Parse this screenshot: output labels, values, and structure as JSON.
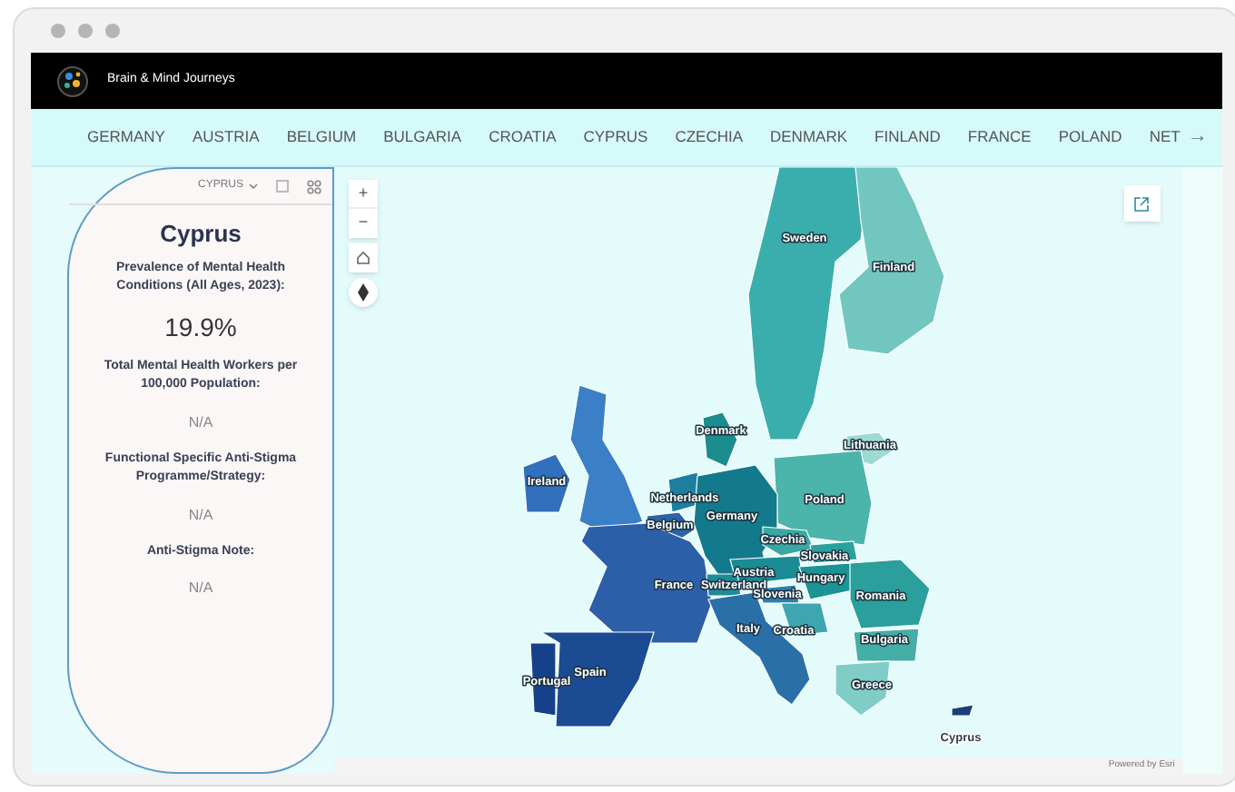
{
  "header": {
    "title": "Brain & Mind Journeys"
  },
  "nav": {
    "items": [
      {
        "label": "GERMANY",
        "selected": false
      },
      {
        "label": "AUSTRIA",
        "selected": false
      },
      {
        "label": "BELGIUM",
        "selected": false
      },
      {
        "label": "BULGARIA",
        "selected": false
      },
      {
        "label": "CROATIA",
        "selected": false
      },
      {
        "label": "CYPRUS",
        "selected": false
      },
      {
        "label": "CZECHIA",
        "selected": false
      },
      {
        "label": "DENMARK",
        "selected": false
      },
      {
        "label": "FINLAND",
        "selected": false
      },
      {
        "label": "FRANCE",
        "selected": false
      },
      {
        "label": "POLAND",
        "selected": false
      },
      {
        "label": "NET",
        "selected": false
      }
    ],
    "next": "→"
  },
  "panel": {
    "dropdown": "CYPRUS",
    "title": "Cyprus",
    "fields": [
      {
        "label": "Prevalence of Mental Health Conditions (All Ages, **2023**):",
        "value": "19.9%",
        "kind": "large"
      },
      {
        "label": "Total Mental Health Workers per **100,000** Population:",
        "value": "N/A",
        "kind": "small"
      },
      {
        "label": "Functional Specific Anti-Stigma Programme/Strategy:",
        "value": "N/A",
        "kind": "small"
      },
      {
        "label": "Anti-Stigma Note:",
        "value": "N/A",
        "kind": "small"
      }
    ]
  },
  "map": {
    "zoom_in": "+",
    "zoom_out": "−",
    "countries": [
      {
        "name": "Sweden",
        "color": "#3aaead"
      },
      {
        "name": "Finland",
        "color": "#72c6c0"
      },
      {
        "name": "Denmark",
        "color": "#1b8d8e"
      },
      {
        "name": "Lithuania",
        "color": "#9fd9d3"
      },
      {
        "name": "Ireland",
        "color": "#3170bd"
      },
      {
        "name": "Netherlands",
        "color": "#1c7fa0"
      },
      {
        "name": "Poland",
        "color": "#4bb4ab"
      },
      {
        "name": "Germany",
        "color": "#137a8e"
      },
      {
        "name": "Belgium",
        "color": "#2a64a6"
      },
      {
        "name": "Czechia",
        "color": "#3aa7a3"
      },
      {
        "name": "Slovakia",
        "color": "#2aa19e"
      },
      {
        "name": "Austria",
        "color": "#1b8b95"
      },
      {
        "name": "Hungary",
        "color": "#1a9494"
      },
      {
        "name": "France",
        "color": "#2d5ea8"
      },
      {
        "name": "Switzerland",
        "color": "#1e8b98"
      },
      {
        "name": "Slovenia",
        "color": "#2d7fb0"
      },
      {
        "name": "Romania",
        "color": "#2a9f9c"
      },
      {
        "name": "Italy",
        "color": "#2a70a8"
      },
      {
        "name": "Croatia",
        "color": "#3da6b0"
      },
      {
        "name": "Bulgaria",
        "color": "#44aea7"
      },
      {
        "name": "Spain",
        "color": "#1b4b93"
      },
      {
        "name": "Portugal",
        "color": "#16418a"
      },
      {
        "name": "Greece",
        "color": "#7fcdc6"
      },
      {
        "name": "Cyprus",
        "color": "#1a3f7a"
      }
    ],
    "attribution": "Powered by Esri"
  }
}
